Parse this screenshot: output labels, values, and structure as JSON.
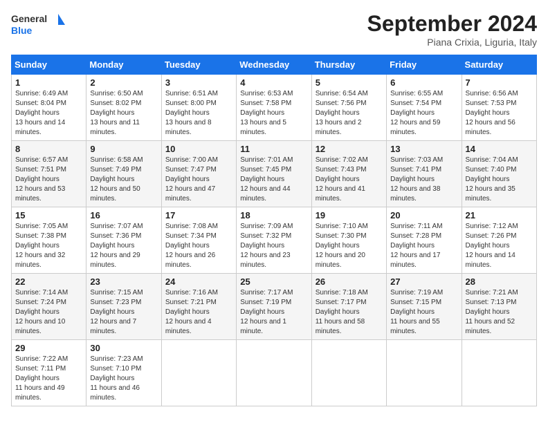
{
  "header": {
    "logo_line1": "General",
    "logo_line2": "Blue",
    "month_year": "September 2024",
    "location": "Piana Crixia, Liguria, Italy"
  },
  "weekdays": [
    "Sunday",
    "Monday",
    "Tuesday",
    "Wednesday",
    "Thursday",
    "Friday",
    "Saturday"
  ],
  "weeks": [
    [
      {
        "day": "1",
        "rise": "6:49 AM",
        "set": "8:04 PM",
        "daylight": "13 hours and 14 minutes."
      },
      {
        "day": "2",
        "rise": "6:50 AM",
        "set": "8:02 PM",
        "daylight": "13 hours and 11 minutes."
      },
      {
        "day": "3",
        "rise": "6:51 AM",
        "set": "8:00 PM",
        "daylight": "13 hours and 8 minutes."
      },
      {
        "day": "4",
        "rise": "6:53 AM",
        "set": "7:58 PM",
        "daylight": "13 hours and 5 minutes."
      },
      {
        "day": "5",
        "rise": "6:54 AM",
        "set": "7:56 PM",
        "daylight": "13 hours and 2 minutes."
      },
      {
        "day": "6",
        "rise": "6:55 AM",
        "set": "7:54 PM",
        "daylight": "12 hours and 59 minutes."
      },
      {
        "day": "7",
        "rise": "6:56 AM",
        "set": "7:53 PM",
        "daylight": "12 hours and 56 minutes."
      }
    ],
    [
      {
        "day": "8",
        "rise": "6:57 AM",
        "set": "7:51 PM",
        "daylight": "12 hours and 53 minutes."
      },
      {
        "day": "9",
        "rise": "6:58 AM",
        "set": "7:49 PM",
        "daylight": "12 hours and 50 minutes."
      },
      {
        "day": "10",
        "rise": "7:00 AM",
        "set": "7:47 PM",
        "daylight": "12 hours and 47 minutes."
      },
      {
        "day": "11",
        "rise": "7:01 AM",
        "set": "7:45 PM",
        "daylight": "12 hours and 44 minutes."
      },
      {
        "day": "12",
        "rise": "7:02 AM",
        "set": "7:43 PM",
        "daylight": "12 hours and 41 minutes."
      },
      {
        "day": "13",
        "rise": "7:03 AM",
        "set": "7:41 PM",
        "daylight": "12 hours and 38 minutes."
      },
      {
        "day": "14",
        "rise": "7:04 AM",
        "set": "7:40 PM",
        "daylight": "12 hours and 35 minutes."
      }
    ],
    [
      {
        "day": "15",
        "rise": "7:05 AM",
        "set": "7:38 PM",
        "daylight": "12 hours and 32 minutes."
      },
      {
        "day": "16",
        "rise": "7:07 AM",
        "set": "7:36 PM",
        "daylight": "12 hours and 29 minutes."
      },
      {
        "day": "17",
        "rise": "7:08 AM",
        "set": "7:34 PM",
        "daylight": "12 hours and 26 minutes."
      },
      {
        "day": "18",
        "rise": "7:09 AM",
        "set": "7:32 PM",
        "daylight": "12 hours and 23 minutes."
      },
      {
        "day": "19",
        "rise": "7:10 AM",
        "set": "7:30 PM",
        "daylight": "12 hours and 20 minutes."
      },
      {
        "day": "20",
        "rise": "7:11 AM",
        "set": "7:28 PM",
        "daylight": "12 hours and 17 minutes."
      },
      {
        "day": "21",
        "rise": "7:12 AM",
        "set": "7:26 PM",
        "daylight": "12 hours and 14 minutes."
      }
    ],
    [
      {
        "day": "22",
        "rise": "7:14 AM",
        "set": "7:24 PM",
        "daylight": "12 hours and 10 minutes."
      },
      {
        "day": "23",
        "rise": "7:15 AM",
        "set": "7:23 PM",
        "daylight": "12 hours and 7 minutes."
      },
      {
        "day": "24",
        "rise": "7:16 AM",
        "set": "7:21 PM",
        "daylight": "12 hours and 4 minutes."
      },
      {
        "day": "25",
        "rise": "7:17 AM",
        "set": "7:19 PM",
        "daylight": "12 hours and 1 minute."
      },
      {
        "day": "26",
        "rise": "7:18 AM",
        "set": "7:17 PM",
        "daylight": "11 hours and 58 minutes."
      },
      {
        "day": "27",
        "rise": "7:19 AM",
        "set": "7:15 PM",
        "daylight": "11 hours and 55 minutes."
      },
      {
        "day": "28",
        "rise": "7:21 AM",
        "set": "7:13 PM",
        "daylight": "11 hours and 52 minutes."
      }
    ],
    [
      {
        "day": "29",
        "rise": "7:22 AM",
        "set": "7:11 PM",
        "daylight": "11 hours and 49 minutes."
      },
      {
        "day": "30",
        "rise": "7:23 AM",
        "set": "7:10 PM",
        "daylight": "11 hours and 46 minutes."
      },
      null,
      null,
      null,
      null,
      null
    ]
  ],
  "labels": {
    "sunrise": "Sunrise:",
    "sunset": "Sunset:",
    "daylight": "Daylight hours"
  }
}
